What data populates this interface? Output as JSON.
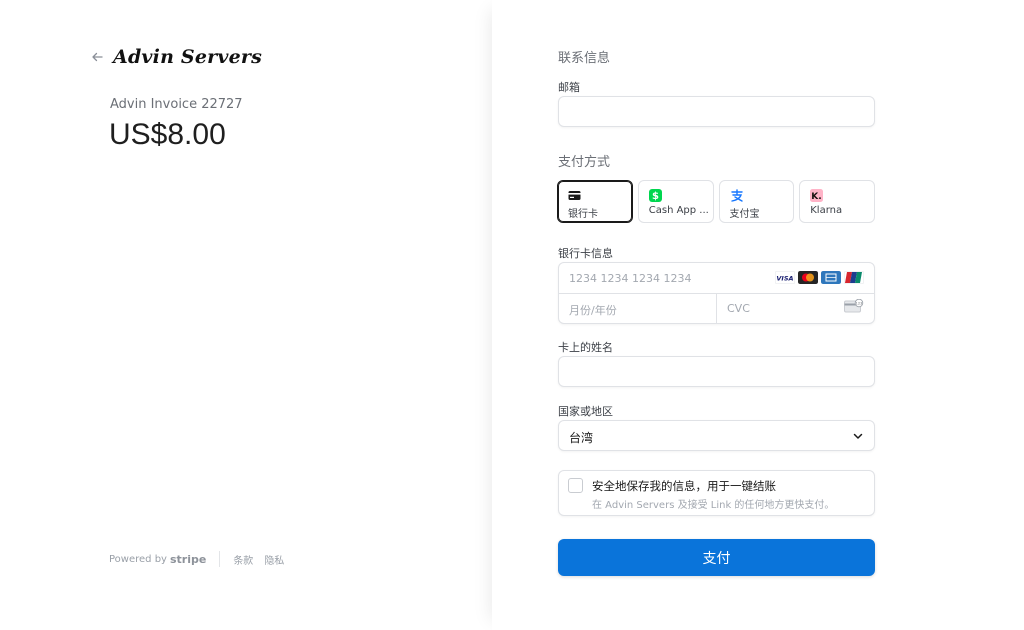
{
  "merchant": {
    "back_icon": "arrow-left-icon",
    "name": "Advin Servers",
    "invoice": "Advin Invoice 22727",
    "amount": "US$8.00"
  },
  "footer": {
    "powered_by": "Powered by",
    "stripe": "stripe",
    "terms": "条款",
    "privacy": "隐私"
  },
  "contact": {
    "title": "联系信息",
    "email_label": "邮箱",
    "email_value": ""
  },
  "payment": {
    "title": "支付方式",
    "methods": [
      {
        "label": "银行卡",
        "icon": "card-icon",
        "selected": true
      },
      {
        "label": "Cash App ...",
        "icon": "cash-app-icon",
        "selected": false
      },
      {
        "label": "支付宝",
        "icon": "alipay-icon",
        "selected": false
      },
      {
        "label": "Klarna",
        "icon": "klarna-icon",
        "selected": false
      }
    ],
    "card_label": "银行卡信息",
    "card_number_placeholder": "1234 1234 1234 1234",
    "expiry_placeholder": "月份/年份",
    "cvc_placeholder": "CVC",
    "card_brands": [
      "visa-icon",
      "mastercard-icon",
      "amex-icon",
      "unionpay-icon"
    ],
    "name_label": "卡上的姓名",
    "name_value": "",
    "country_label": "国家或地区",
    "country_value": "台湾"
  },
  "save_info": {
    "title": "安全地保存我的信息，用于一键结账",
    "subtitle": "在 Advin Servers 及接受 Link 的任何地方更快支付。",
    "checked": false
  },
  "pay_button": "支付",
  "colors": {
    "primary": "#0a74da",
    "border": "#e0e2e6",
    "text_muted": "#6b6f76"
  }
}
